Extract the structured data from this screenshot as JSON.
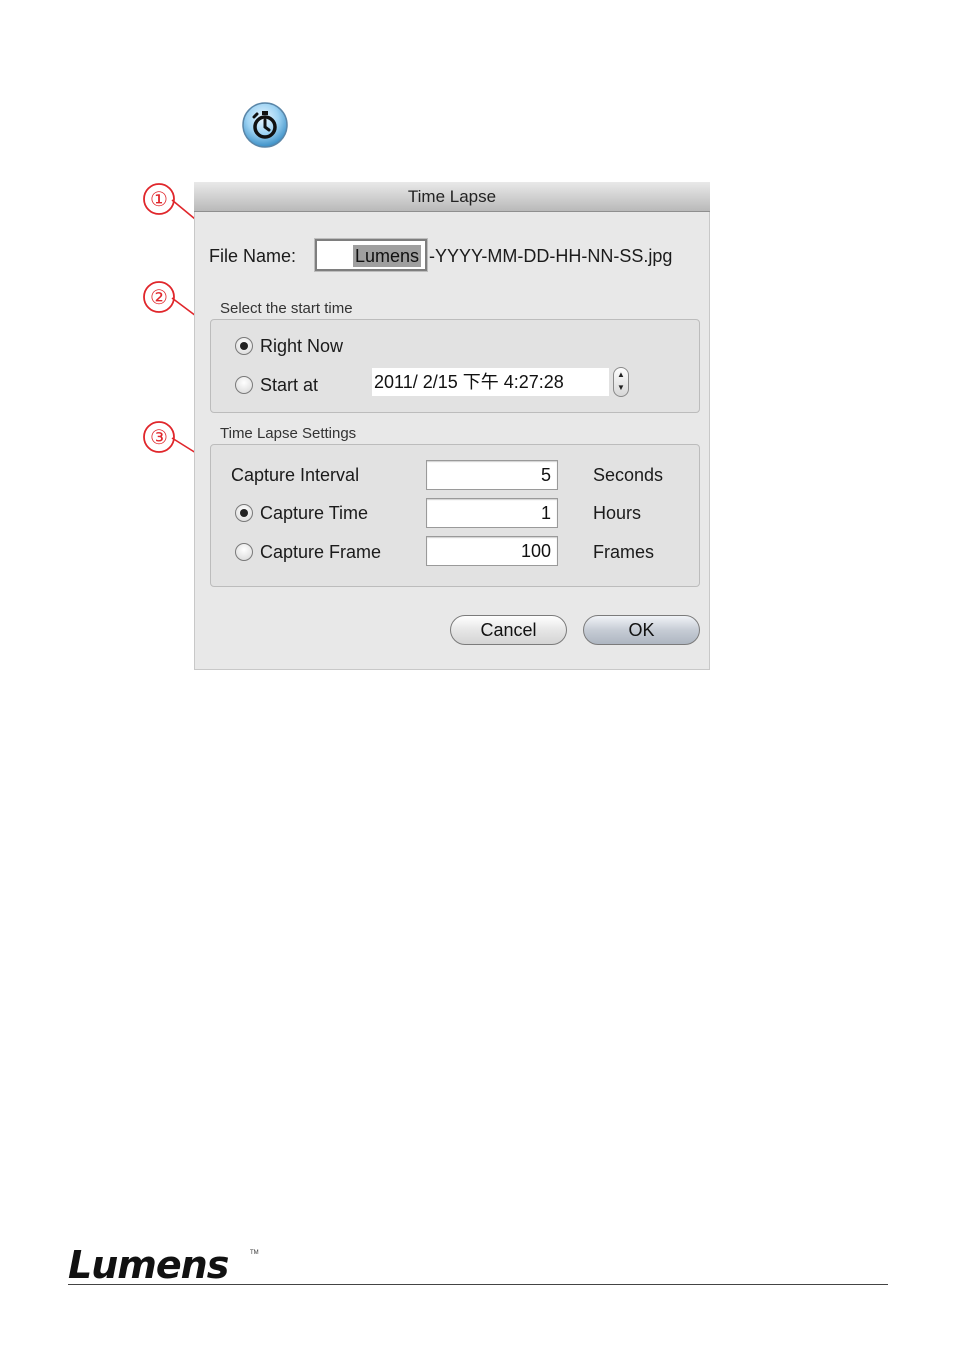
{
  "timer_icon": "stopwatch-icon",
  "callouts": [
    "①",
    "②",
    "③"
  ],
  "dialog": {
    "title": "Time Lapse",
    "file_name_label": "File Name:",
    "file_name_value": "Lumens",
    "file_name_suffix": "-YYYY-MM-DD-HH-NN-SS.jpg",
    "start_group_title": "Select the start time",
    "right_now_label": "Right Now",
    "start_at_label": "Start at",
    "start_at_value": "2011/  2/15 下午   4:27:28",
    "selected_start": "Right Now",
    "settings_group_title": "Time Lapse Settings",
    "capture_interval_label": "Capture Interval",
    "capture_interval_value": "5",
    "capture_interval_unit": "Seconds",
    "capture_time_label": "Capture Time",
    "capture_time_value": "1",
    "capture_time_unit": "Hours",
    "capture_frame_label": "Capture Frame",
    "capture_frame_value": "100",
    "capture_frame_unit": "Frames",
    "selected_capture_mode": "Capture Time",
    "cancel_label": "Cancel",
    "ok_label": "OK"
  },
  "footer": {
    "logo_text": "Lumens",
    "logo_tm": "TM"
  },
  "colors": {
    "callout": "#e0262b",
    "dialog_bg": "#e8e8e8",
    "selection": "#9f9f9f"
  }
}
